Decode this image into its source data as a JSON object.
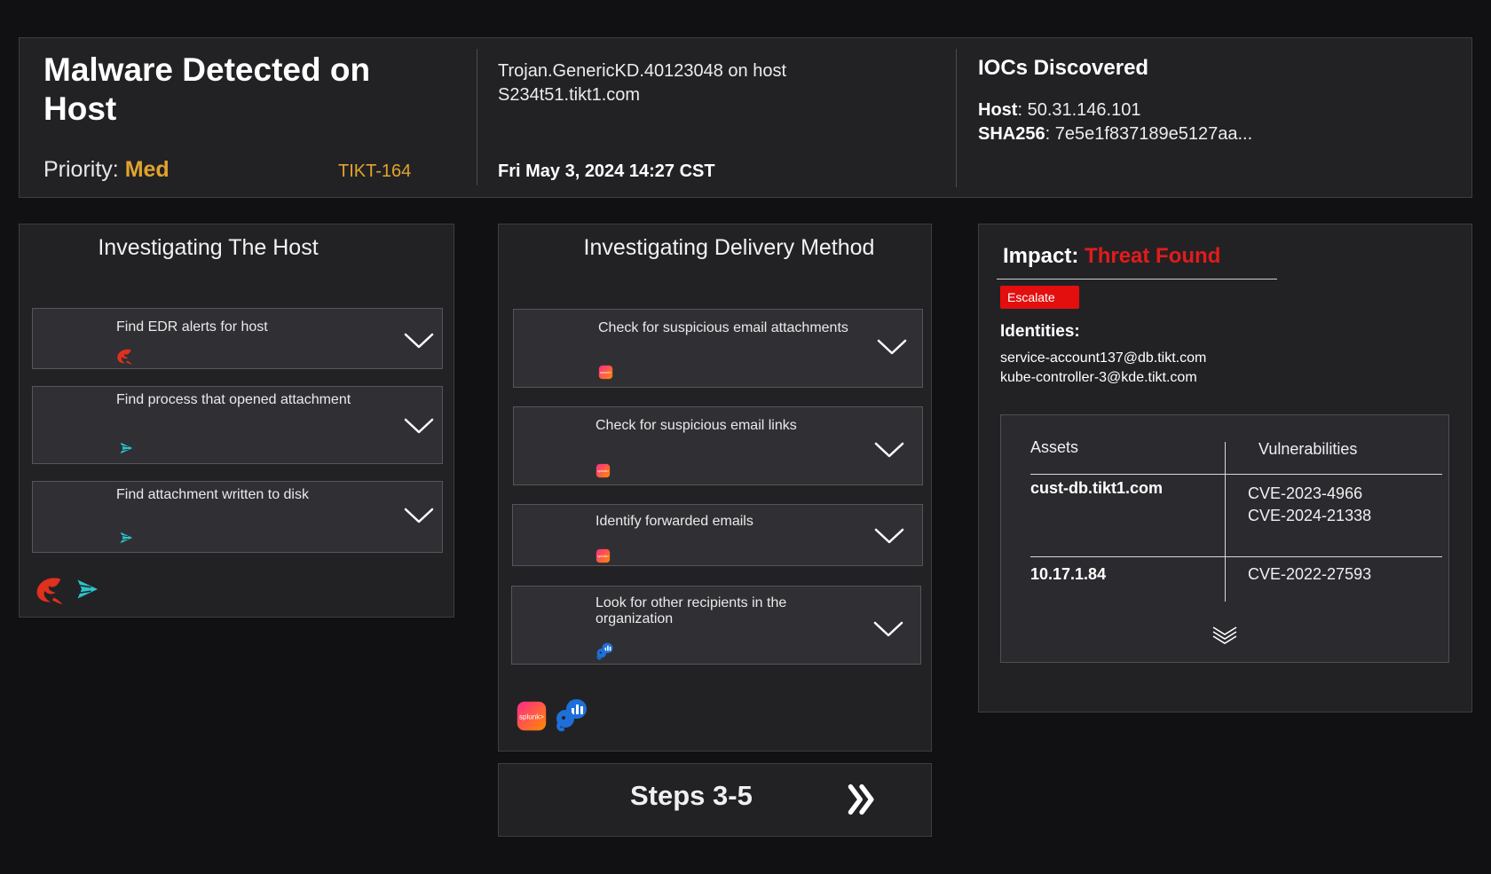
{
  "header": {
    "title": "Malware Detected on Host",
    "priority_label": "Priority:",
    "priority_value": "Med",
    "ticket_id": "TIKT-164",
    "detection": "Trojan.GenericKD.40123048 on host S234t51.tikt1.com",
    "timestamp": "Fri May 3, 2024 14:27 CST",
    "iocs": {
      "title": "IOCs Discovered",
      "host_label": "Host",
      "host_value": ": 50.31.146.101",
      "sha_label": "SHA256",
      "sha_value": ": 7e5e1f837189e5127aa..."
    }
  },
  "host_column": {
    "title": "Investigating The Host",
    "tasks": [
      {
        "label": "Find EDR alerts for host",
        "tool_icon": "crowdstrike-falcon-icon"
      },
      {
        "label": "Find process that opened attachment",
        "tool_icon": "sentinelone-arrow-icon"
      },
      {
        "label": "Find attachment written to disk",
        "tool_icon": "sentinelone-arrow-icon"
      }
    ],
    "tools": [
      "crowdstrike-falcon-icon",
      "sentinelone-arrow-icon"
    ]
  },
  "delivery_column": {
    "title": "Investigating Delivery Method",
    "tasks": [
      {
        "label": "Check for suspicious email attachments",
        "tool_icon": "splunk-icon"
      },
      {
        "label": "Check for suspicious email links",
        "tool_icon": "splunk-icon"
      },
      {
        "label": "Identify forwarded emails",
        "tool_icon": "splunk-icon"
      },
      {
        "label": "Look for other recipients in the organization",
        "tool_icon": "analytics-elephant-icon"
      }
    ],
    "tools": [
      "splunk-icon",
      "analytics-elephant-icon"
    ],
    "splunk_logo_text": "splunk>"
  },
  "impact": {
    "label": "Impact:",
    "status": "Threat Found",
    "escalate_label": "Escalate",
    "identities_title": "Identities:",
    "identities": [
      "service-account137@db.tikt.com",
      "kube-controller-3@kde.tikt.com"
    ],
    "assets_header": "Assets",
    "vulns_header": "Vulnerabilities",
    "rows": [
      {
        "asset": "cust-db.tikt1.com",
        "vulns": [
          "CVE-2023-4966",
          "CVE-2024-21338"
        ]
      },
      {
        "asset": "10.17.1.84",
        "vulns": [
          "CVE-2022-27593"
        ]
      }
    ]
  },
  "steps_button": {
    "label": "Steps 3-5",
    "icon": "double-chevron-right-icon"
  },
  "colors": {
    "background": "#111113",
    "panel": "#222225",
    "priority_orange": "#e2a32d",
    "threat_red": "#e31b1b",
    "escalate_red": "#e30f0f",
    "sentinel_teal": "#2dc3c9",
    "crowdstrike_red": "#e0301e"
  }
}
